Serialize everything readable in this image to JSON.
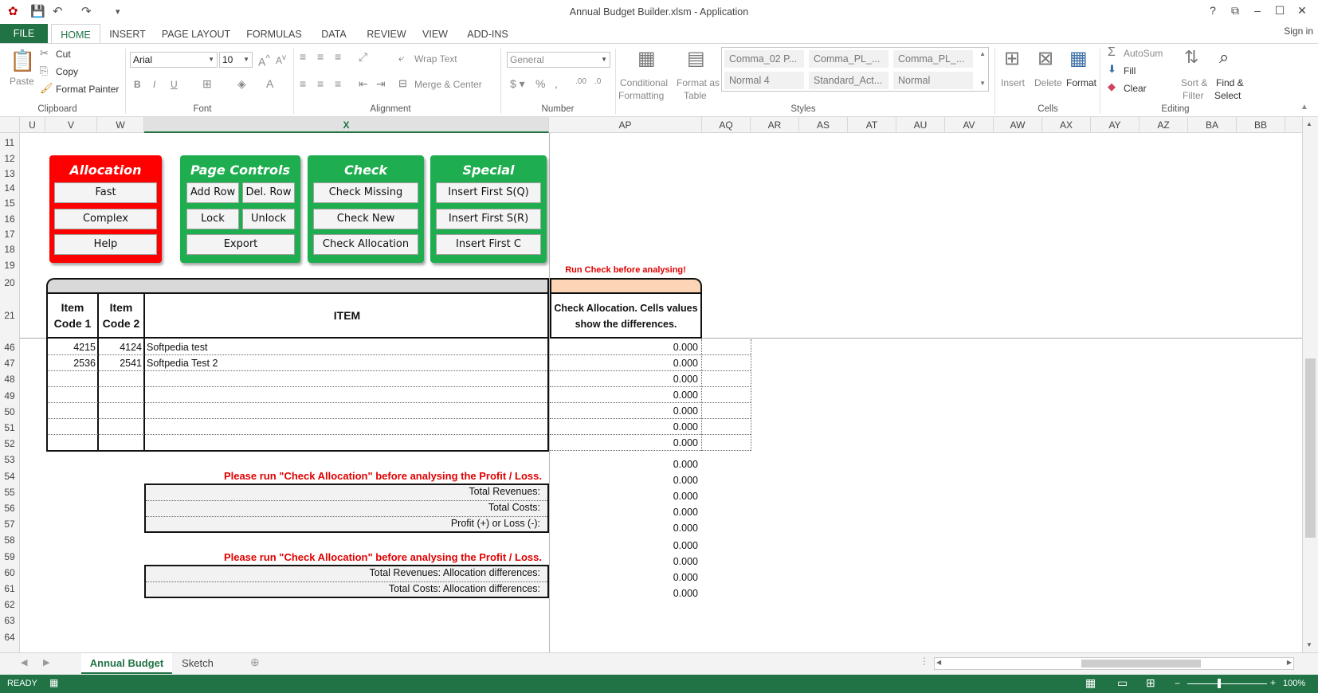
{
  "window": {
    "title": "Annual Budget Builder.xlsm - Application",
    "help_glyph": "?",
    "sign_in": "Sign in"
  },
  "ribbon_tabs": [
    "FILE",
    "HOME",
    "INSERT",
    "PAGE LAYOUT",
    "FORMULAS",
    "DATA",
    "REVIEW",
    "VIEW",
    "ADD-INS"
  ],
  "ribbon": {
    "clipboard": {
      "paste": "Paste",
      "cut": "Cut",
      "copy": "Copy",
      "format_painter": "Format Painter",
      "label": "Clipboard"
    },
    "font": {
      "name": "Arial",
      "size": "10",
      "label": "Font"
    },
    "alignment": {
      "wrap": "Wrap Text",
      "merge": "Merge & Center",
      "label": "Alignment"
    },
    "number": {
      "format": "General",
      "label": "Number"
    },
    "styles": {
      "conditional": "Conditional",
      "conditional2": "Formatting",
      "format_as": "Format as",
      "format_as2": "Table",
      "gallery": [
        "Comma_02 P...",
        "Comma_PL_...",
        "Comma_PL_...",
        "Normal 4",
        "Standard_Act...",
        "Normal"
      ],
      "label": "Styles"
    },
    "cells": {
      "insert": "Insert",
      "delete": "Delete",
      "format": "Format",
      "label": "Cells"
    },
    "editing": {
      "autosum": "AutoSum",
      "fill": "Fill",
      "clear": "Clear",
      "sort": "Sort &",
      "sort2": "Filter",
      "find": "Find &",
      "find2": "Select",
      "label": "Editing"
    }
  },
  "columns": [
    "U",
    "V",
    "W",
    "X",
    "AP",
    "AQ",
    "AR",
    "AS",
    "AT",
    "AU",
    "AV",
    "AW",
    "AX",
    "AY",
    "AZ",
    "BA",
    "BB"
  ],
  "rows_top": [
    "11",
    "12",
    "13",
    "14",
    "15",
    "16",
    "17",
    "18",
    "19",
    "20",
    "21"
  ],
  "rows_bottom": [
    "46",
    "47",
    "48",
    "49",
    "50",
    "51",
    "52",
    "53",
    "54",
    "55",
    "56",
    "57",
    "58",
    "59",
    "60",
    "61",
    "62",
    "63",
    "64"
  ],
  "panels": {
    "allocation": {
      "title": "Allocation",
      "buttons": [
        "Fast",
        "Complex",
        "Help"
      ]
    },
    "page_controls": {
      "title": "Page Controls",
      "buttons": [
        "Add Row",
        "Del. Row",
        "Lock",
        "Unlock",
        "Export"
      ]
    },
    "check": {
      "title": "Check",
      "buttons": [
        "Check Missing",
        "Check New",
        "Check Allocation"
      ]
    },
    "special": {
      "title": "Special",
      "buttons": [
        "Insert First S(Q)",
        "Insert First S(R)",
        "Insert First C"
      ]
    }
  },
  "table": {
    "run_check_note": "Run Check before analysing!",
    "headers": {
      "code1_a": "Item",
      "code1_b": "Code 1",
      "code2_a": "Item",
      "code2_b": "Code 2",
      "item": "ITEM",
      "check_a": "Check Allocation. Cells values",
      "check_b": "show the differences."
    },
    "rows": [
      {
        "code1": "4215",
        "code2": "4124",
        "item": "Softpedia test",
        "diff": "0.000"
      },
      {
        "code1": "2536",
        "code2": "2541",
        "item": "Softpedia Test 2",
        "diff": "0.000"
      },
      {
        "code1": "",
        "code2": "",
        "item": "",
        "diff": "0.000"
      },
      {
        "code1": "",
        "code2": "",
        "item": "",
        "diff": "0.000"
      },
      {
        "code1": "",
        "code2": "",
        "item": "",
        "diff": "0.000"
      },
      {
        "code1": "",
        "code2": "",
        "item": "",
        "diff": "0.000"
      },
      {
        "code1": "",
        "code2": "",
        "item": "",
        "diff": "0.000"
      }
    ],
    "extra_diffs": [
      "0.000",
      "0.000",
      "0.000",
      "0.000",
      "0.000",
      "0.000",
      "0.000",
      "0.000",
      "0.000"
    ]
  },
  "summary": {
    "warning1": "Please run \"Check Allocation\" before analysing the Profit / Loss.",
    "total_revenues": "Total Revenues:",
    "total_costs": "Total Costs:",
    "profit_loss": "Profit (+) or Loss (-):",
    "warning2": "Please run \"Check Allocation\" before analysing the Profit / Loss.",
    "alloc_revenues": "Total Revenues: Allocation differences:",
    "alloc_costs": "Total Costs: Allocation differences:"
  },
  "sheet_tabs": [
    "Annual Budget",
    "Sketch"
  ],
  "status": {
    "ready": "READY",
    "zoom": "100%"
  },
  "colors": {
    "excel_green": "#217346",
    "panel_red": "#ff0000",
    "panel_green": "#1fae4f",
    "warning_red": "#e00000",
    "check_header_bg": "#fbd5b5"
  }
}
